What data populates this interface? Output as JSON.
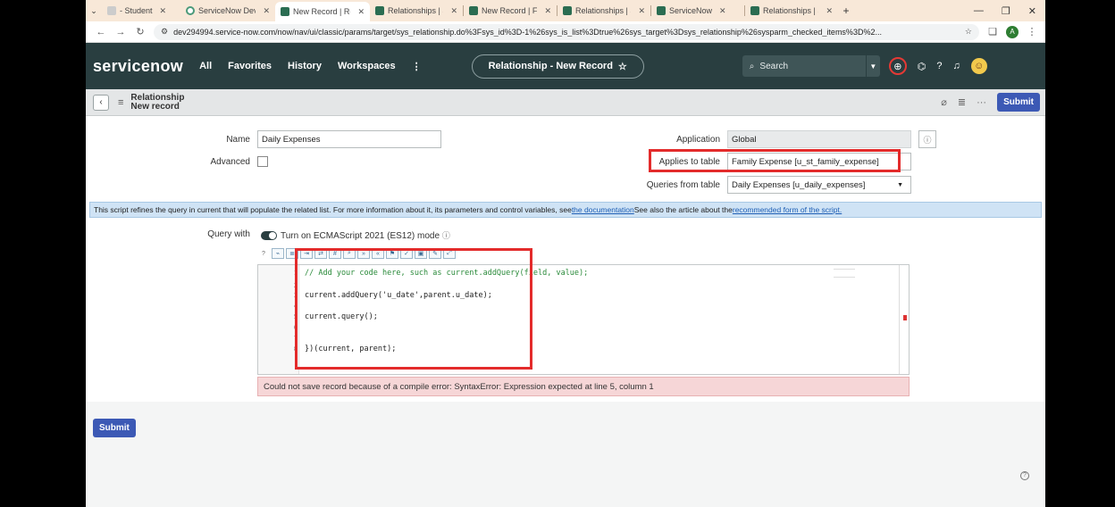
{
  "browser": {
    "tabs": [
      {
        "title": "- Student",
        "active": false
      },
      {
        "title": "ServiceNow Dev",
        "active": false
      },
      {
        "title": "New Record | Re",
        "active": true
      },
      {
        "title": "Relationships | S",
        "active": false
      },
      {
        "title": "New Record | Fa",
        "active": false
      },
      {
        "title": "Relationships | S",
        "active": false
      },
      {
        "title": "ServiceNow",
        "active": false
      },
      {
        "title": "Relationships | S",
        "active": false
      }
    ],
    "new_tab": "+",
    "url": "dev294994.service-now.com/now/nav/ui/classic/params/target/sys_relationship.do%3Fsys_id%3D-1%26sys_is_list%3Dtrue%26sys_target%3Dsys_relationship%26sysparm_checked_items%3D%2...",
    "profile_initial": "A"
  },
  "header": {
    "logo": "servicenow",
    "nav": [
      "All",
      "Favorites",
      "History",
      "Workspaces"
    ],
    "more": "⋮",
    "context_title": "Relationship - New Record",
    "search_placeholder": "Search"
  },
  "form": {
    "title_line1": "Relationship",
    "title_line2": "New record",
    "submit_label": "Submit",
    "fields": {
      "name_label": "Name",
      "name_value": "Daily Expenses",
      "advanced_label": "Advanced",
      "application_label": "Application",
      "application_value": "Global",
      "applies_label": "Applies to table",
      "applies_value": "Family Expense [u_st_family_expense]",
      "queries_label": "Queries from table",
      "queries_value": "Daily Expenses [u_daily_expenses]"
    },
    "info": {
      "text": "This script refines the query in current that will populate the related list. For more information about it, its parameters and control variables, see ",
      "link1": "the documentation",
      "mid": " See also the article about the ",
      "link2": "recommended form of the script."
    },
    "query_with_label": "Query with",
    "ecma_label": "Turn on ECMAScript 2021 (ES12) mode",
    "code_lines": [
      {
        "n": "1",
        "text": "// Add your code here, such as current.addQuery(field, value);"
      },
      {
        "n": "2",
        "text": ""
      },
      {
        "n": "3",
        "text": "current.addQuery('u_date',parent.u_date);"
      },
      {
        "n": "4",
        "text": ""
      },
      {
        "n": "5",
        "text": "current.query();"
      },
      {
        "n": "6",
        "text": ""
      },
      {
        "n": "7",
        "text": ""
      },
      {
        "n": "8",
        "text": "})(current, parent);"
      }
    ],
    "error": "Could not save record because of a compile error: SyntaxError: Expression expected at line 5, column 1"
  }
}
